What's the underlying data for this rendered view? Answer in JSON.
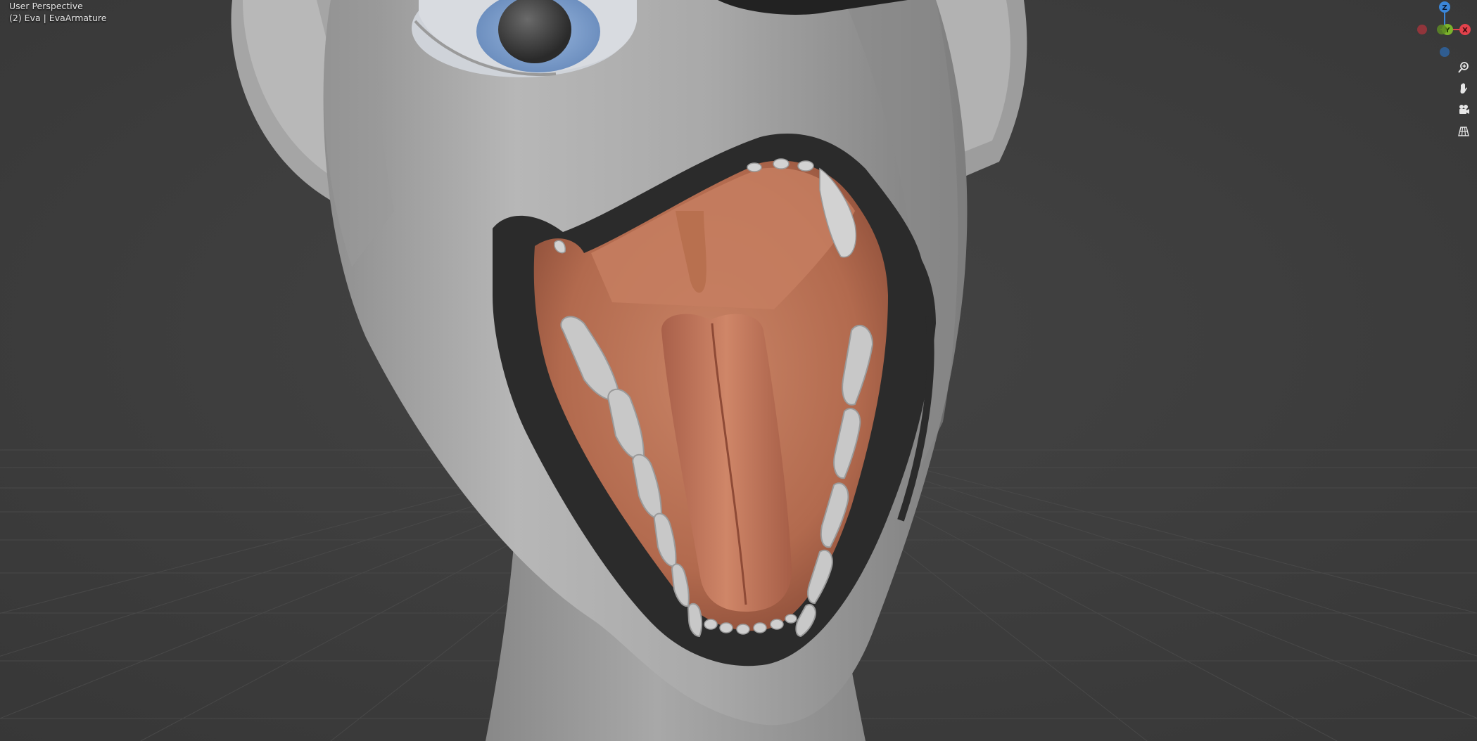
{
  "viewport": {
    "view_name": "User Perspective",
    "object_info": "(2) Eva | EvaArmature"
  },
  "gizmo": {
    "axis_x_label": "X",
    "axis_y_label": "Y",
    "axis_z_label": "Z",
    "colors": {
      "x": "#e3424c",
      "y": "#7cb32b",
      "z": "#3b86d8"
    }
  },
  "navigation": {
    "buttons": [
      "zoom-icon",
      "hand-pan-icon",
      "camera-icon",
      "ortho-grid-icon"
    ]
  },
  "scene": {
    "background": "#3d3d3d",
    "subject": "character-head-open-mouth"
  }
}
